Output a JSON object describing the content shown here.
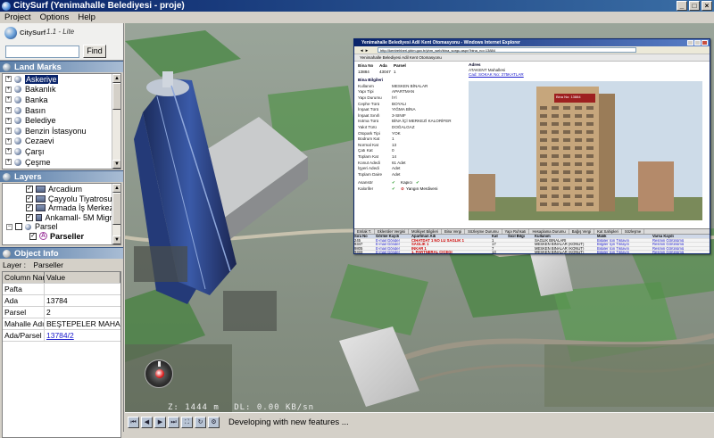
{
  "window": {
    "title": "CitySurf  (Yenimahalle Belediyesi - proje)",
    "buttons": [
      "_",
      "□",
      "×"
    ]
  },
  "menu": [
    {
      "label": "Project",
      "key": "P"
    },
    {
      "label": "Options",
      "key": "O"
    },
    {
      "label": "Help",
      "key": "H"
    }
  ],
  "logo": {
    "name": "CitySurf",
    "version": "1.1 - Lite"
  },
  "search": {
    "value": "",
    "button": "Find"
  },
  "landmarks": {
    "title": "Land Marks",
    "items": [
      "Askeriye",
      "Bakanlık",
      "Banka",
      "Basın",
      "Belediye",
      "Benzin İstasyonu",
      "Cezaevi",
      "Çarşı",
      "Çeşme"
    ],
    "selected": "Askeriye"
  },
  "layers": {
    "title": "Layers",
    "items": [
      {
        "label": "Arcadium",
        "checked": true
      },
      {
        "label": "Çayyolu Tiyatrosu",
        "checked": true
      },
      {
        "label": "Armada İş Merkezi",
        "checked": true
      },
      {
        "label": "Ankamall- 5M Migros",
        "checked": true
      }
    ],
    "group": "Parsel",
    "sublayer": "Parseller"
  },
  "object_info": {
    "title": "Object Info",
    "layer_label": "Layer :",
    "layer_value": "Parseller",
    "columns": [
      "Column Name",
      "Value"
    ],
    "rows": [
      {
        "name": "Pafta",
        "value": ""
      },
      {
        "name": "Ada",
        "value": "13784"
      },
      {
        "name": "Parsel",
        "value": "2"
      },
      {
        "name": "Mahalle Adı",
        "value": "BEŞTEPELER MAHALLESİ"
      },
      {
        "name": "Ada/Parsel",
        "value": "13784/2",
        "link": true
      }
    ]
  },
  "popup": {
    "title": "Yenimahalle Belediyesi Adil Kent Otomasyonu - Windows Internet Explorer",
    "address": "http://kentrehberi.ybim.gov.tr/ybm_web/bina_sorgu.aspx?bina_no=13884",
    "tab": "Yenimahalle Belediyesi Adil Kent Otomasyonu",
    "bina_no_label": "Bina No",
    "ada_label": "Ada",
    "parsel_label": "Parsel",
    "bina_no": "13884",
    "ada": "43047",
    "parsel": "1",
    "bilgi_title": "Bina Bilgileri",
    "fields": [
      [
        "Kullanım",
        "MESKEN BİNALAR"
      ],
      [
        "Yapı Tipi",
        "APARTMAN"
      ],
      [
        "Yapı Durumu",
        "İYİ"
      ],
      [
        "Cephe Türü",
        "BOYALI"
      ],
      [
        "İnşaat Türü",
        "YIĞMA BİNA"
      ],
      [
        "İnşaat Sınıfı",
        "3-SINIF"
      ],
      [
        "Isıtma Türü",
        "BİNA İÇİ MERKEZİ KALORİFER"
      ],
      [
        "Yakıt Türü",
        "DOĞALGAZ"
      ],
      [
        "Otopark Tipi",
        "YOK"
      ],
      [
        "Bodrum Kat",
        "1"
      ],
      [
        "Normal Kat",
        "13"
      ],
      [
        "Çatı Kat",
        "0"
      ],
      [
        "Toplam Kat",
        "14"
      ],
      [
        "Konut Adedi",
        "61 Adet"
      ],
      [
        "İşyeri Adedi",
        "Adet"
      ],
      [
        "Toplam Daire",
        "Adet"
      ]
    ],
    "asansor": "Asansör",
    "kapici": "Kapıcı",
    "kalorifer": "Kalorifer",
    "yangin": "Yangın Merdiveni",
    "adres_title": "Adres",
    "adres_value": "ATAKENT Mahallesi",
    "adres_link": "Cad: SOKAK No: 375KATLAR",
    "photo_caption": "Bina No: 13884",
    "grid_tabs": [
      "Emlak T.",
      "Eklentiler Vergisi",
      "Mülkiyet Bilgileri",
      "Bina Vergi",
      "Sözleşme Durumu",
      "Yapı Ruhsatı",
      "Hesaplama Durumu",
      "Bağış Vergi",
      "Kat Sahipleri",
      "Sözleşme"
    ],
    "grid_columns": [
      "Sıra No",
      "Görme Kaydı",
      "Apartman Adı",
      "Kat",
      "Sicil Bilgi",
      "Kullanım",
      "Malik",
      "Varsa Kaydı"
    ],
    "grid_rows": [
      [
        "245",
        "E-mail Gönder",
        "CİHATDAT 1 NO LU SAĞLIK 1",
        "1",
        "",
        "SAĞLIK BİNALARI",
        "Bilgiler İçin Tıklayın",
        "Resmin Görünümü"
      ],
      [
        "9347",
        "E-mail Gönder",
        "SAĞLIK 1",
        "17",
        "",
        "MESKEN BİNALAR (KONUT)",
        "Bilgiler İçin Tıklayın",
        "Resmin Görünümü"
      ],
      [
        "9805",
        "E-mail Gönder",
        "İNKAR 1",
        "7",
        "",
        "MESKEN BİNALAR (KONUT)",
        "Bilgiler İçin Tıklayın",
        "Resmin Görünümü"
      ],
      [
        "9333",
        "E-mail Gönder",
        "1. PARTNERAL ÇİÇEĞİ",
        "13",
        "",
        "MESKEN BİNALAR (KONUT)",
        "Bilgiler İçin Tıklayın",
        "Resmin Görünümü"
      ],
      [
        "9326",
        "E-mail Gönder",
        "1. PARTNERAL ÇİÇEĞİ",
        "13",
        "",
        "MESKEN BİNALAR (KONUT)",
        "Bilgiler İçin Tıklayın",
        "Resmin Görünümü"
      ]
    ]
  },
  "hud": {
    "zoom": "Z: 1444 m",
    "download": "DL: 0.00 KB/sn"
  },
  "status": {
    "text": "Developing with new features ...",
    "buttons": [
      "first-icon",
      "prev-icon",
      "next-icon",
      "last-icon",
      "fullscreen-icon",
      "refresh-icon",
      "settings-icon"
    ]
  },
  "colors": {
    "title_gradient_start": "#0a246a",
    "selection": "#0a246a",
    "link": "#1a1acc"
  }
}
